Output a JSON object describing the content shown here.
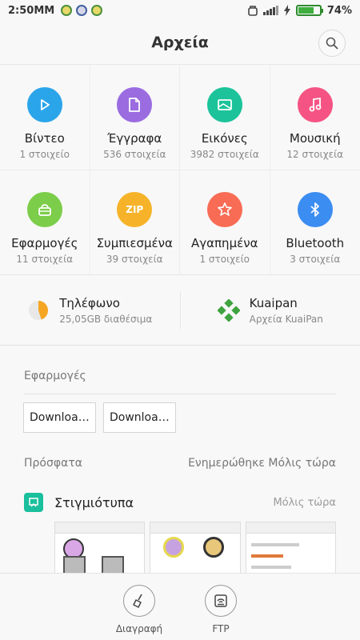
{
  "status_bar": {
    "time": "2:50",
    "time_suffix": "MM",
    "battery": "74%",
    "battery_level": 0.74
  },
  "header": {
    "title": "Αρχεία",
    "search_icon": "search-icon"
  },
  "categories": [
    {
      "name": "Βίντεο",
      "count": "1 στοιχείο",
      "color": "#2ba5ea",
      "icon": "play-icon"
    },
    {
      "name": "Έγγραφα",
      "count": "536 στοιχεία",
      "color": "#9a6ce0",
      "icon": "document-icon"
    },
    {
      "name": "Εικόνες",
      "count": "3982 στοιχεία",
      "color": "#1cc39a",
      "icon": "image-icon"
    },
    {
      "name": "Μουσική",
      "count": "12 στοιχεία",
      "color": "#f55383",
      "icon": "music-icon"
    },
    {
      "name": "Εφαρμογές",
      "count": "11 στοιχεία",
      "color": "#7ccd4a",
      "icon": "app-icon"
    },
    {
      "name": "Συμπιεσμένα",
      "count": "39 στοιχεία",
      "color": "#f6b329",
      "icon": "zip-icon",
      "glyph": "ZIP"
    },
    {
      "name": "Αγαπημένα",
      "count": "1 στοιχείο",
      "color": "#f86c55",
      "icon": "star-icon"
    },
    {
      "name": "Bluetooth",
      "count": "3 στοιχεία",
      "color": "#3b8df2",
      "icon": "bluetooth-icon"
    }
  ],
  "storage": [
    {
      "title": "Τηλέφωνο",
      "subtitle": "25,05GB διαθέσιμα",
      "icon": "pie-storage-icon",
      "used_fraction": 0.45
    },
    {
      "title": "Kuaipan",
      "subtitle": "Αρχεία KuaiPan",
      "icon": "kuaipan-icon"
    }
  ],
  "apps_section": {
    "title": "Εφαρμογές",
    "chips": [
      "Downloa…",
      "Downloa…"
    ]
  },
  "recent": {
    "title": "Πρόσφατα",
    "updated": "Ενημερώθηκε Μόλις τώρα",
    "group_label": "Στιγμιότυπα",
    "group_time": "Μόλις τώρα"
  },
  "bottom_bar": {
    "clean_label": "Διαγραφή",
    "ftp_label": "FTP"
  }
}
